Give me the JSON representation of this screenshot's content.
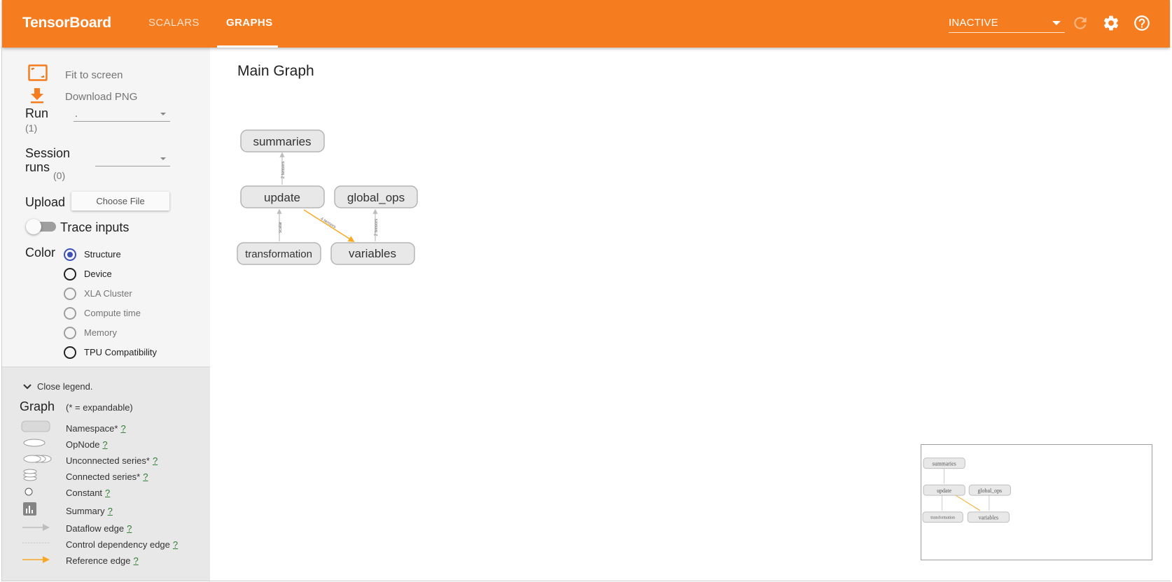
{
  "app": {
    "brand": "TensorBoard",
    "tabs": [
      {
        "label": "SCALARS",
        "active": false
      },
      {
        "label": "GRAPHS",
        "active": true
      }
    ],
    "run_status": "INACTIVE",
    "icons": {
      "refresh": "refresh-icon",
      "settings": "gear-icon",
      "help": "help-icon"
    },
    "accent_color": "#f57c1f"
  },
  "sidebar": {
    "fit_to_screen": "Fit to screen",
    "download_png": "Download PNG",
    "run_label": "Run",
    "run_count": "(1)",
    "run_value": ".",
    "session_label_1": "Session",
    "session_label_2": "runs",
    "session_count": "(0)",
    "upload_label": "Upload",
    "choose_file": "Choose File",
    "trace_inputs": "Trace inputs",
    "color_label": "Color",
    "color_options": [
      {
        "label": "Structure",
        "checked": true,
        "disabled": false
      },
      {
        "label": "Device",
        "checked": false,
        "disabled": false
      },
      {
        "label": "XLA Cluster",
        "checked": false,
        "disabled": true
      },
      {
        "label": "Compute time",
        "checked": false,
        "disabled": true
      },
      {
        "label": "Memory",
        "checked": false,
        "disabled": true
      },
      {
        "label": "TPU Compatibility",
        "checked": false,
        "disabled": false
      }
    ]
  },
  "legend": {
    "close": "Close legend.",
    "title": "Graph",
    "note": "(* = expandable)",
    "help_mark": "?",
    "items": [
      {
        "label": "Namespace*",
        "icon": "namespace-icon"
      },
      {
        "label": "OpNode",
        "icon": "opnode-icon"
      },
      {
        "label": "Unconnected series*",
        "icon": "unconnected-series-icon"
      },
      {
        "label": "Connected series*",
        "icon": "connected-series-icon"
      },
      {
        "label": "Constant",
        "icon": "constant-icon"
      },
      {
        "label": "Summary",
        "icon": "summary-icon"
      },
      {
        "label": "Dataflow edge",
        "icon": "dataflow-edge-icon"
      },
      {
        "label": "Control dependency edge",
        "icon": "control-edge-icon"
      },
      {
        "label": "Reference edge",
        "icon": "reference-edge-icon"
      }
    ]
  },
  "graph": {
    "title": "Main Graph",
    "nodes": [
      "summaries",
      "update",
      "global_ops",
      "transformation",
      "variables"
    ],
    "edge_labels": [
      "2 tensors",
      "scalar",
      "4 tensors",
      "2 tensors"
    ],
    "reference_color": "#f9a825"
  }
}
